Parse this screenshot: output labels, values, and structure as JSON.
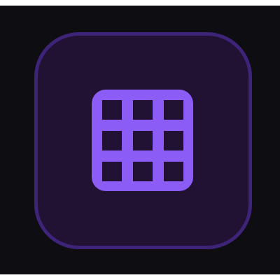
{
  "theme": {
    "background": "#0d0d12",
    "tile_fill": "#211234",
    "tile_border": "#3e2478",
    "icon_color": "#8b5cf6"
  },
  "app_icon": {
    "icon": "grid-icon"
  }
}
